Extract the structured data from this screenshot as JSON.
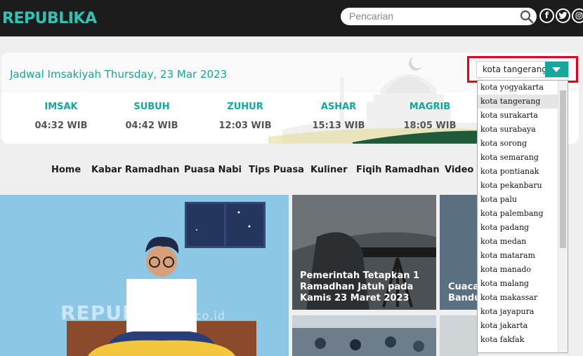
{
  "header": {
    "logo": "REPUBLIKA",
    "search_placeholder": "Pencarian",
    "icons": [
      "search-icon",
      "facebook-icon",
      "twitter-icon",
      "instagram-icon"
    ]
  },
  "imsakiyah": {
    "title": "Jadwal Imsakiyah Thursday, 23 Mar 2023",
    "selected_city": "kota tangerang",
    "prayers": [
      {
        "name": "IMSAK",
        "time": "04:32 WIB"
      },
      {
        "name": "SUBUH",
        "time": "04:42 WIB"
      },
      {
        "name": "ZUHUR",
        "time": "12:03 WIB"
      },
      {
        "name": "ASHAR",
        "time": "15:13 WIB"
      },
      {
        "name": "MAGRIB",
        "time": "18:05 WIB"
      }
    ],
    "city_options": [
      "kota yogyakarta",
      "kota tangerang",
      "kota surakarta",
      "kota surabaya",
      "kota sorong",
      "kota semarang",
      "kota pontianak",
      "kota pekanbaru",
      "kota palu",
      "kota palembang",
      "kota padang",
      "kota medan",
      "kota mataram",
      "kota manado",
      "kota malang",
      "kota makassar",
      "kota jayapura",
      "kota jakarta",
      "kota fakfak"
    ]
  },
  "nav": {
    "items": [
      "Home",
      "Kabar Ramadhan",
      "Puasa Nabi",
      "Tips Puasa",
      "Kuliner",
      "Fiqih Ramadhan",
      "Video"
    ]
  },
  "content": {
    "hero_watermark": "REPUBLIKA",
    "hero_watermark_suffix": ".co.id",
    "card1_title": "Pemerintah Tetapkan 1 Ramadhan Jatuh pada Kamis 23 Maret 2023",
    "card2_title": "Cuaca Bandu"
  },
  "colors": {
    "brand": "#2fc3b4",
    "accent": "#13a89e",
    "header_bg": "#1c1c1c",
    "highlight": "#e3001b"
  }
}
